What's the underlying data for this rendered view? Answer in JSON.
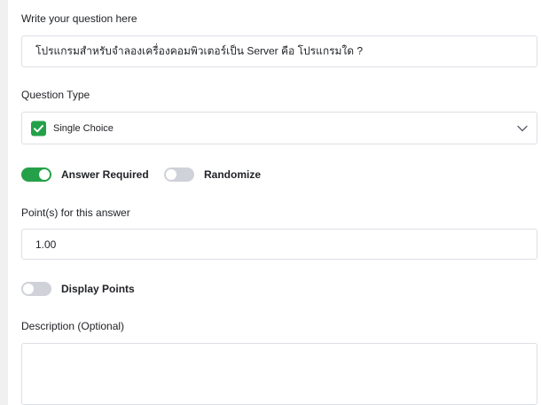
{
  "question": {
    "label": "Write your question here",
    "value": "โปรแกรมสำหรับจำลองเครื่องคอมพิวเตอร์เป็น Server คือ โปรแกรมใด ?"
  },
  "question_type": {
    "label": "Question Type",
    "selected": "Single Choice",
    "icon": "check-icon"
  },
  "toggles": {
    "answer_required": {
      "label": "Answer Required",
      "on": true
    },
    "randomize": {
      "label": "Randomize",
      "on": false
    },
    "display_points": {
      "label": "Display Points",
      "on": false
    }
  },
  "points": {
    "label": "Point(s) for this answer",
    "value": "1.00"
  },
  "description": {
    "label": "Description (Optional)",
    "value": ""
  },
  "colors": {
    "accent": "#24a148",
    "toggle_off": "#cfd2d8",
    "border": "#dcdfe5",
    "background": "#f0f0f1"
  }
}
